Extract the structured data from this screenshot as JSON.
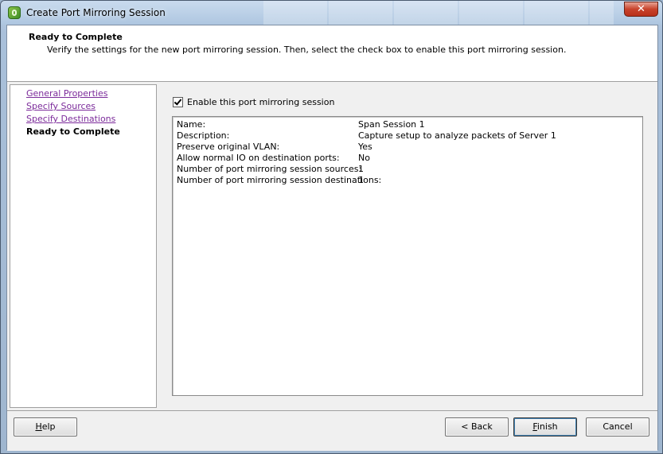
{
  "window": {
    "title": "Create Port Mirroring Session",
    "close_symbol": "✕"
  },
  "header": {
    "title": "Ready to Complete",
    "subtitle": "Verify the settings for the new port mirroring session. Then, select the check box to enable this port mirroring session."
  },
  "nav": {
    "items": [
      {
        "label": "General Properties",
        "state": "visited"
      },
      {
        "label": "Specify Sources",
        "state": "visited"
      },
      {
        "label": "Specify Destinations",
        "state": "visited"
      },
      {
        "label": "Ready to Complete",
        "state": "current"
      }
    ]
  },
  "enable": {
    "label": "Enable this port mirroring session",
    "checked": true
  },
  "summary": {
    "rows": [
      {
        "label": "Name:",
        "value": "Span Session 1"
      },
      {
        "label": "Description:",
        "value": "Capture setup to analyze packets of Server 1"
      },
      {
        "label": "Preserve original VLAN:",
        "value": "Yes"
      },
      {
        "label": "Allow normal IO on destination ports:",
        "value": "No"
      },
      {
        "label": "Number of port mirroring session sources:",
        "value": "1"
      },
      {
        "label": "Number of port mirroring session destinations:",
        "value": "1"
      }
    ]
  },
  "footer": {
    "help_label": "Help",
    "back_label": "< Back",
    "finish_label": "Finish",
    "cancel_label": "Cancel"
  },
  "colors": {
    "link_visited": "#7b2a9a",
    "titlebar": "#aec6e0",
    "close_button": "#c8432c"
  }
}
